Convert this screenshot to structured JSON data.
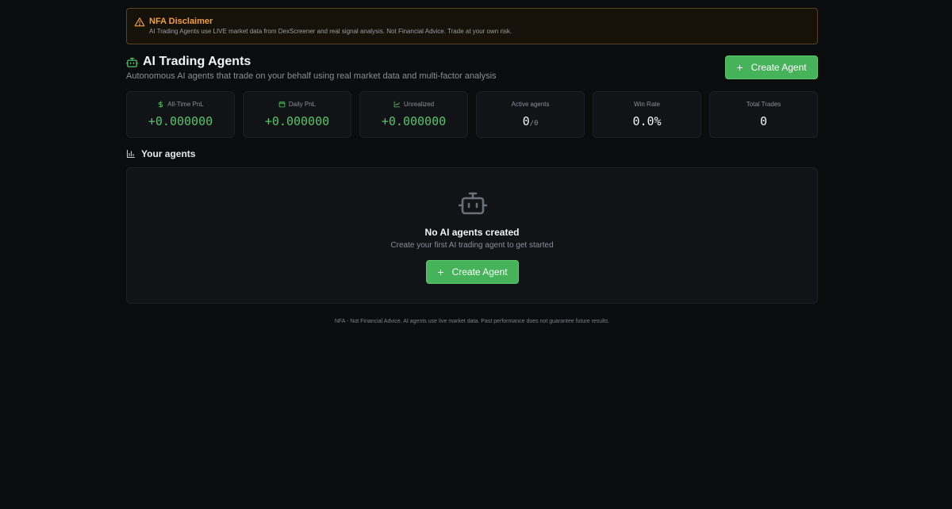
{
  "disclaimer": {
    "title": "NFA Disclaimer",
    "text": "AI Trading Agents use LIVE market data from DexScreener and real signal analysis. Not Financial Advice. Trade at your own risk.",
    "icon": "warning-triangle-icon"
  },
  "header": {
    "title": "AI Trading Agents",
    "subtitle": "Autonomous AI agents that trade on your behalf using real market data and multi-factor analysis",
    "icon": "robot-icon",
    "create_label": "Create Agent"
  },
  "stats": [
    {
      "label": "All-Time PnL",
      "value": "+0.000000",
      "icon": "dollar-icon"
    },
    {
      "label": "Daily PnL",
      "value": "+0.000000",
      "icon": "calendar-icon"
    },
    {
      "label": "Unrealized",
      "value": "+0.000000",
      "icon": "trend-chart-icon"
    },
    {
      "label": "Active agents",
      "value": "0",
      "sub": "/0"
    },
    {
      "label": "Win Rate",
      "value": "0.0%"
    },
    {
      "label": "Total Trades",
      "value": "0"
    }
  ],
  "agents": {
    "title": "Your agents",
    "empty_title": "No AI agents created",
    "empty_subtitle": "Create your first AI trading agent to get started",
    "create_label": "Create Agent"
  },
  "footer": {
    "text": "NFA - Not Financial Advice. AI agents use live market data. Past performance does not guarantee future results."
  },
  "colors": {
    "accent": "#46b35a",
    "positive": "#56c46a",
    "warning": "#f0a040",
    "background": "#0b0c0e"
  }
}
